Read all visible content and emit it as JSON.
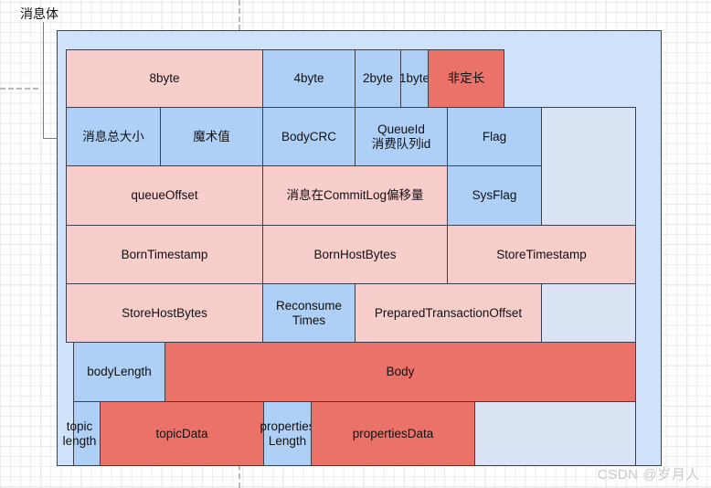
{
  "annotation": {
    "label": "消息体"
  },
  "watermark": "CSDN @岁月人",
  "colors": {
    "pink": "#f8cecc",
    "blue": "#aed0f6",
    "red": "#ea7268",
    "gray": "#dae3f3",
    "container": "#cfe2f9",
    "border": "#3a3f4a",
    "arrow": "#e8524b"
  },
  "rows": [
    {
      "name": "size-legend-row",
      "cells": [
        {
          "label": "8byte",
          "color": "pink"
        },
        {
          "label": "4byte",
          "color": "blue"
        },
        {
          "label": "2byte",
          "color": "blue"
        },
        {
          "label": "1byte",
          "color": "blue"
        },
        {
          "label": "非定长",
          "color": "red"
        }
      ]
    },
    {
      "name": "header-fields-row",
      "cells": [
        {
          "label": "消息总大小",
          "color": "blue"
        },
        {
          "label": "魔术值",
          "color": "blue"
        },
        {
          "label": "BodyCRC",
          "color": "blue"
        },
        {
          "label": "QueueId\n消费队列id",
          "color": "blue"
        },
        {
          "label": "Flag",
          "color": "blue"
        },
        {
          "label": "",
          "color": "gray"
        }
      ]
    },
    {
      "name": "offset-fields-row",
      "cells": [
        {
          "label": "queueOffset",
          "color": "pink"
        },
        {
          "label": "消息在CommitLog偏移量",
          "color": "pink"
        },
        {
          "label": "SysFlag",
          "color": "blue"
        },
        {
          "label": "",
          "color": "gray"
        }
      ]
    },
    {
      "name": "timestamp-fields-row",
      "cells": [
        {
          "label": "BornTimestamp",
          "color": "pink"
        },
        {
          "label": "BornHostBytes",
          "color": "pink"
        },
        {
          "label": "StoreTimestamp",
          "color": "pink"
        }
      ]
    },
    {
      "name": "store-fields-row",
      "cells": [
        {
          "label": "StoreHostBytes",
          "color": "pink"
        },
        {
          "label": "Reconsume\nTimes",
          "color": "blue"
        },
        {
          "label": "PreparedTransactionOffset",
          "color": "pink"
        },
        {
          "label": "",
          "color": "gray"
        }
      ]
    },
    {
      "name": "body-fields-row",
      "cells": [
        {
          "label": "bodyLength",
          "color": "blue"
        },
        {
          "label": "Body",
          "color": "red"
        },
        {
          "label": "",
          "color": "gray"
        }
      ]
    },
    {
      "name": "topic-properties-row",
      "cells": [
        {
          "label": "topic\nlength",
          "color": "blue"
        },
        {
          "label": "topicData",
          "color": "red"
        },
        {
          "label": "properties\nLength",
          "color": "blue"
        },
        {
          "label": "propertiesData",
          "color": "red"
        },
        {
          "label": "",
          "color": "gray"
        }
      ]
    }
  ]
}
